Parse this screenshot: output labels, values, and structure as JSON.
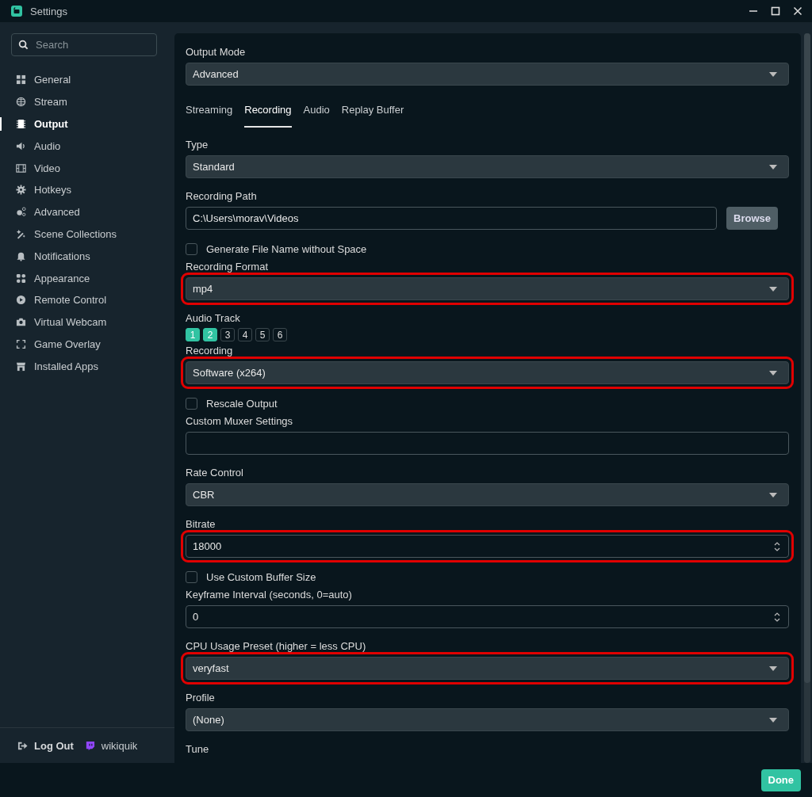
{
  "window": {
    "title": "Settings"
  },
  "sidebar": {
    "search": {
      "placeholder": "Search"
    },
    "items": [
      {
        "label": "General",
        "selected": false
      },
      {
        "label": "Stream",
        "selected": false
      },
      {
        "label": "Output",
        "selected": true
      },
      {
        "label": "Audio",
        "selected": false
      },
      {
        "label": "Video",
        "selected": false
      },
      {
        "label": "Hotkeys",
        "selected": false
      },
      {
        "label": "Advanced",
        "selected": false
      },
      {
        "label": "Scene Collections",
        "selected": false
      },
      {
        "label": "Notifications",
        "selected": false
      },
      {
        "label": "Appearance",
        "selected": false
      },
      {
        "label": "Remote Control",
        "selected": false
      },
      {
        "label": "Virtual Webcam",
        "selected": false
      },
      {
        "label": "Game Overlay",
        "selected": false
      },
      {
        "label": "Installed Apps",
        "selected": false
      }
    ],
    "logout": "Log Out",
    "account": "wikiquik"
  },
  "form": [
    {
      "kind": "select",
      "label": "Output Mode",
      "value": "Advanced",
      "highlighted": false
    },
    {
      "kind": "tabs",
      "tabs": [
        {
          "label": "Streaming",
          "selected": false
        },
        {
          "label": "Recording",
          "selected": true
        },
        {
          "label": "Audio",
          "selected": false
        },
        {
          "label": "Replay Buffer",
          "selected": false
        }
      ]
    },
    {
      "kind": "select",
      "label": "Type",
      "value": "Standard",
      "highlighted": false
    },
    {
      "kind": "path",
      "label": "Recording Path",
      "value": "C:\\Users\\morav\\Videos",
      "button": "Browse"
    },
    {
      "kind": "checkbox",
      "label": "Generate File Name without Space",
      "checked": false
    },
    {
      "kind": "select",
      "label": "Recording Format",
      "value": "mp4",
      "highlighted": true
    },
    {
      "kind": "tracks",
      "label": "Audio Track",
      "tracks": [
        {
          "label": "1",
          "selected": true
        },
        {
          "label": "2",
          "selected": true
        },
        {
          "label": "3",
          "selected": false
        },
        {
          "label": "4",
          "selected": false
        },
        {
          "label": "5",
          "selected": false
        },
        {
          "label": "6",
          "selected": false
        }
      ]
    },
    {
      "kind": "select",
      "label": "Recording",
      "value": "Software (x264)",
      "highlighted": true
    },
    {
      "kind": "checkbox",
      "label": "Rescale Output",
      "checked": false
    },
    {
      "kind": "text",
      "label": "Custom Muxer Settings",
      "highlighted": false
    },
    {
      "kind": "select",
      "label": "Rate Control",
      "value": "CBR",
      "highlighted": false
    },
    {
      "kind": "number",
      "label": "Bitrate",
      "value": "18000",
      "highlighted": true
    },
    {
      "kind": "checkbox",
      "label": "Use Custom Buffer Size",
      "checked": false
    },
    {
      "kind": "number",
      "label": "Keyframe Interval (seconds, 0=auto)",
      "value": "0",
      "highlighted": false
    },
    {
      "kind": "select",
      "label": "CPU Usage Preset (higher = less CPU)",
      "value": "veryfast",
      "highlighted": true
    },
    {
      "kind": "select",
      "label": "Profile",
      "value": "(None)",
      "highlighted": false
    },
    {
      "kind": "heading",
      "label": "Tune"
    }
  ],
  "footer": {
    "done": "Done"
  }
}
